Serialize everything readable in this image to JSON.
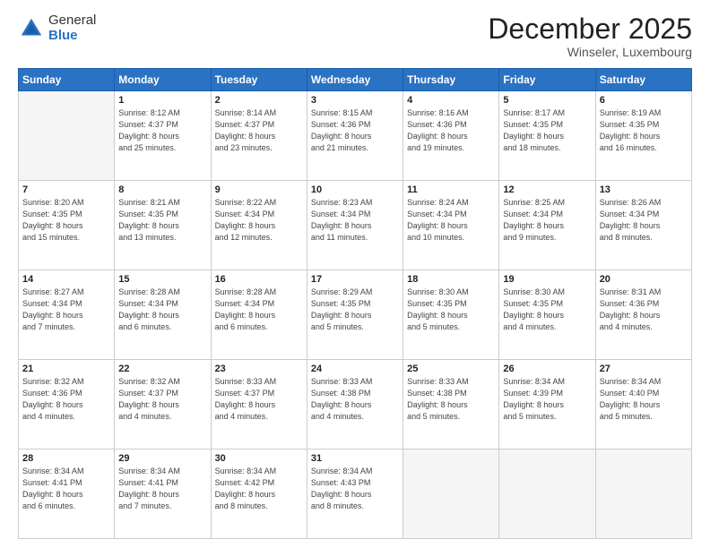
{
  "header": {
    "logo_general": "General",
    "logo_blue": "Blue",
    "month": "December 2025",
    "location": "Winseler, Luxembourg"
  },
  "days_of_week": [
    "Sunday",
    "Monday",
    "Tuesday",
    "Wednesday",
    "Thursday",
    "Friday",
    "Saturday"
  ],
  "weeks": [
    [
      {
        "day": "",
        "info": ""
      },
      {
        "day": "1",
        "info": "Sunrise: 8:12 AM\nSunset: 4:37 PM\nDaylight: 8 hours\nand 25 minutes."
      },
      {
        "day": "2",
        "info": "Sunrise: 8:14 AM\nSunset: 4:37 PM\nDaylight: 8 hours\nand 23 minutes."
      },
      {
        "day": "3",
        "info": "Sunrise: 8:15 AM\nSunset: 4:36 PM\nDaylight: 8 hours\nand 21 minutes."
      },
      {
        "day": "4",
        "info": "Sunrise: 8:16 AM\nSunset: 4:36 PM\nDaylight: 8 hours\nand 19 minutes."
      },
      {
        "day": "5",
        "info": "Sunrise: 8:17 AM\nSunset: 4:35 PM\nDaylight: 8 hours\nand 18 minutes."
      },
      {
        "day": "6",
        "info": "Sunrise: 8:19 AM\nSunset: 4:35 PM\nDaylight: 8 hours\nand 16 minutes."
      }
    ],
    [
      {
        "day": "7",
        "info": "Sunrise: 8:20 AM\nSunset: 4:35 PM\nDaylight: 8 hours\nand 15 minutes."
      },
      {
        "day": "8",
        "info": "Sunrise: 8:21 AM\nSunset: 4:35 PM\nDaylight: 8 hours\nand 13 minutes."
      },
      {
        "day": "9",
        "info": "Sunrise: 8:22 AM\nSunset: 4:34 PM\nDaylight: 8 hours\nand 12 minutes."
      },
      {
        "day": "10",
        "info": "Sunrise: 8:23 AM\nSunset: 4:34 PM\nDaylight: 8 hours\nand 11 minutes."
      },
      {
        "day": "11",
        "info": "Sunrise: 8:24 AM\nSunset: 4:34 PM\nDaylight: 8 hours\nand 10 minutes."
      },
      {
        "day": "12",
        "info": "Sunrise: 8:25 AM\nSunset: 4:34 PM\nDaylight: 8 hours\nand 9 minutes."
      },
      {
        "day": "13",
        "info": "Sunrise: 8:26 AM\nSunset: 4:34 PM\nDaylight: 8 hours\nand 8 minutes."
      }
    ],
    [
      {
        "day": "14",
        "info": "Sunrise: 8:27 AM\nSunset: 4:34 PM\nDaylight: 8 hours\nand 7 minutes."
      },
      {
        "day": "15",
        "info": "Sunrise: 8:28 AM\nSunset: 4:34 PM\nDaylight: 8 hours\nand 6 minutes."
      },
      {
        "day": "16",
        "info": "Sunrise: 8:28 AM\nSunset: 4:34 PM\nDaylight: 8 hours\nand 6 minutes."
      },
      {
        "day": "17",
        "info": "Sunrise: 8:29 AM\nSunset: 4:35 PM\nDaylight: 8 hours\nand 5 minutes."
      },
      {
        "day": "18",
        "info": "Sunrise: 8:30 AM\nSunset: 4:35 PM\nDaylight: 8 hours\nand 5 minutes."
      },
      {
        "day": "19",
        "info": "Sunrise: 8:30 AM\nSunset: 4:35 PM\nDaylight: 8 hours\nand 4 minutes."
      },
      {
        "day": "20",
        "info": "Sunrise: 8:31 AM\nSunset: 4:36 PM\nDaylight: 8 hours\nand 4 minutes."
      }
    ],
    [
      {
        "day": "21",
        "info": "Sunrise: 8:32 AM\nSunset: 4:36 PM\nDaylight: 8 hours\nand 4 minutes."
      },
      {
        "day": "22",
        "info": "Sunrise: 8:32 AM\nSunset: 4:37 PM\nDaylight: 8 hours\nand 4 minutes."
      },
      {
        "day": "23",
        "info": "Sunrise: 8:33 AM\nSunset: 4:37 PM\nDaylight: 8 hours\nand 4 minutes."
      },
      {
        "day": "24",
        "info": "Sunrise: 8:33 AM\nSunset: 4:38 PM\nDaylight: 8 hours\nand 4 minutes."
      },
      {
        "day": "25",
        "info": "Sunrise: 8:33 AM\nSunset: 4:38 PM\nDaylight: 8 hours\nand 5 minutes."
      },
      {
        "day": "26",
        "info": "Sunrise: 8:34 AM\nSunset: 4:39 PM\nDaylight: 8 hours\nand 5 minutes."
      },
      {
        "day": "27",
        "info": "Sunrise: 8:34 AM\nSunset: 4:40 PM\nDaylight: 8 hours\nand 5 minutes."
      }
    ],
    [
      {
        "day": "28",
        "info": "Sunrise: 8:34 AM\nSunset: 4:41 PM\nDaylight: 8 hours\nand 6 minutes."
      },
      {
        "day": "29",
        "info": "Sunrise: 8:34 AM\nSunset: 4:41 PM\nDaylight: 8 hours\nand 7 minutes."
      },
      {
        "day": "30",
        "info": "Sunrise: 8:34 AM\nSunset: 4:42 PM\nDaylight: 8 hours\nand 8 minutes."
      },
      {
        "day": "31",
        "info": "Sunrise: 8:34 AM\nSunset: 4:43 PM\nDaylight: 8 hours\nand 8 minutes."
      },
      {
        "day": "",
        "info": ""
      },
      {
        "day": "",
        "info": ""
      },
      {
        "day": "",
        "info": ""
      }
    ]
  ]
}
